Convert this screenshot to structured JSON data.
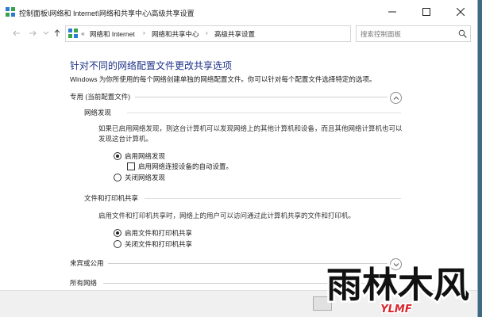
{
  "window": {
    "title": "控制面板\\网络和 Internet\\网络和共享中心\\高级共享设置"
  },
  "address": {
    "overflow": "«",
    "crumbs": [
      "网络和 Internet",
      "网络和共享中心",
      "高级共享设置"
    ],
    "separator": "›"
  },
  "search": {
    "placeholder": "搜索控制面板"
  },
  "main": {
    "heading": "针对不同的网络配置文件更改共享选项",
    "subtitle": "Windows 为你所使用的每个网络创建单独的网络配置文件。你可以针对每个配置文件选择特定的选项。",
    "private_profile": {
      "label": "专用 (当前配置文件)",
      "network_discovery": {
        "title": "网络发现",
        "description": "如果已启用网络发现，则这台计算机可以发现网络上的其他计算机和设备，而且其他网络计算机也可以发现这台计算机。",
        "option_on": "启用网络发现",
        "auto_setup": "启用网络连接设备的自动设置。",
        "option_off": "关闭网络发现",
        "selected": "on",
        "auto_setup_checked": false
      },
      "file_printer_sharing": {
        "title": "文件和打印机共享",
        "description": "启用文件和打印机共享时，网络上的用户可以访问通过此计算机共享的文件和打印机。",
        "option_on": "启用文件和打印机共享",
        "option_off": "关闭文件和打印机共享",
        "selected": "on"
      }
    },
    "guest_profile": {
      "label": "来宾或公用"
    },
    "all_networks": {
      "label": "所有网络"
    }
  },
  "watermark": {
    "text": "雨林木风",
    "latin": "YLMF"
  },
  "colors": {
    "heading": "#1e3287",
    "logo_red": "#d7262c",
    "desktop": "#3f6a84"
  }
}
